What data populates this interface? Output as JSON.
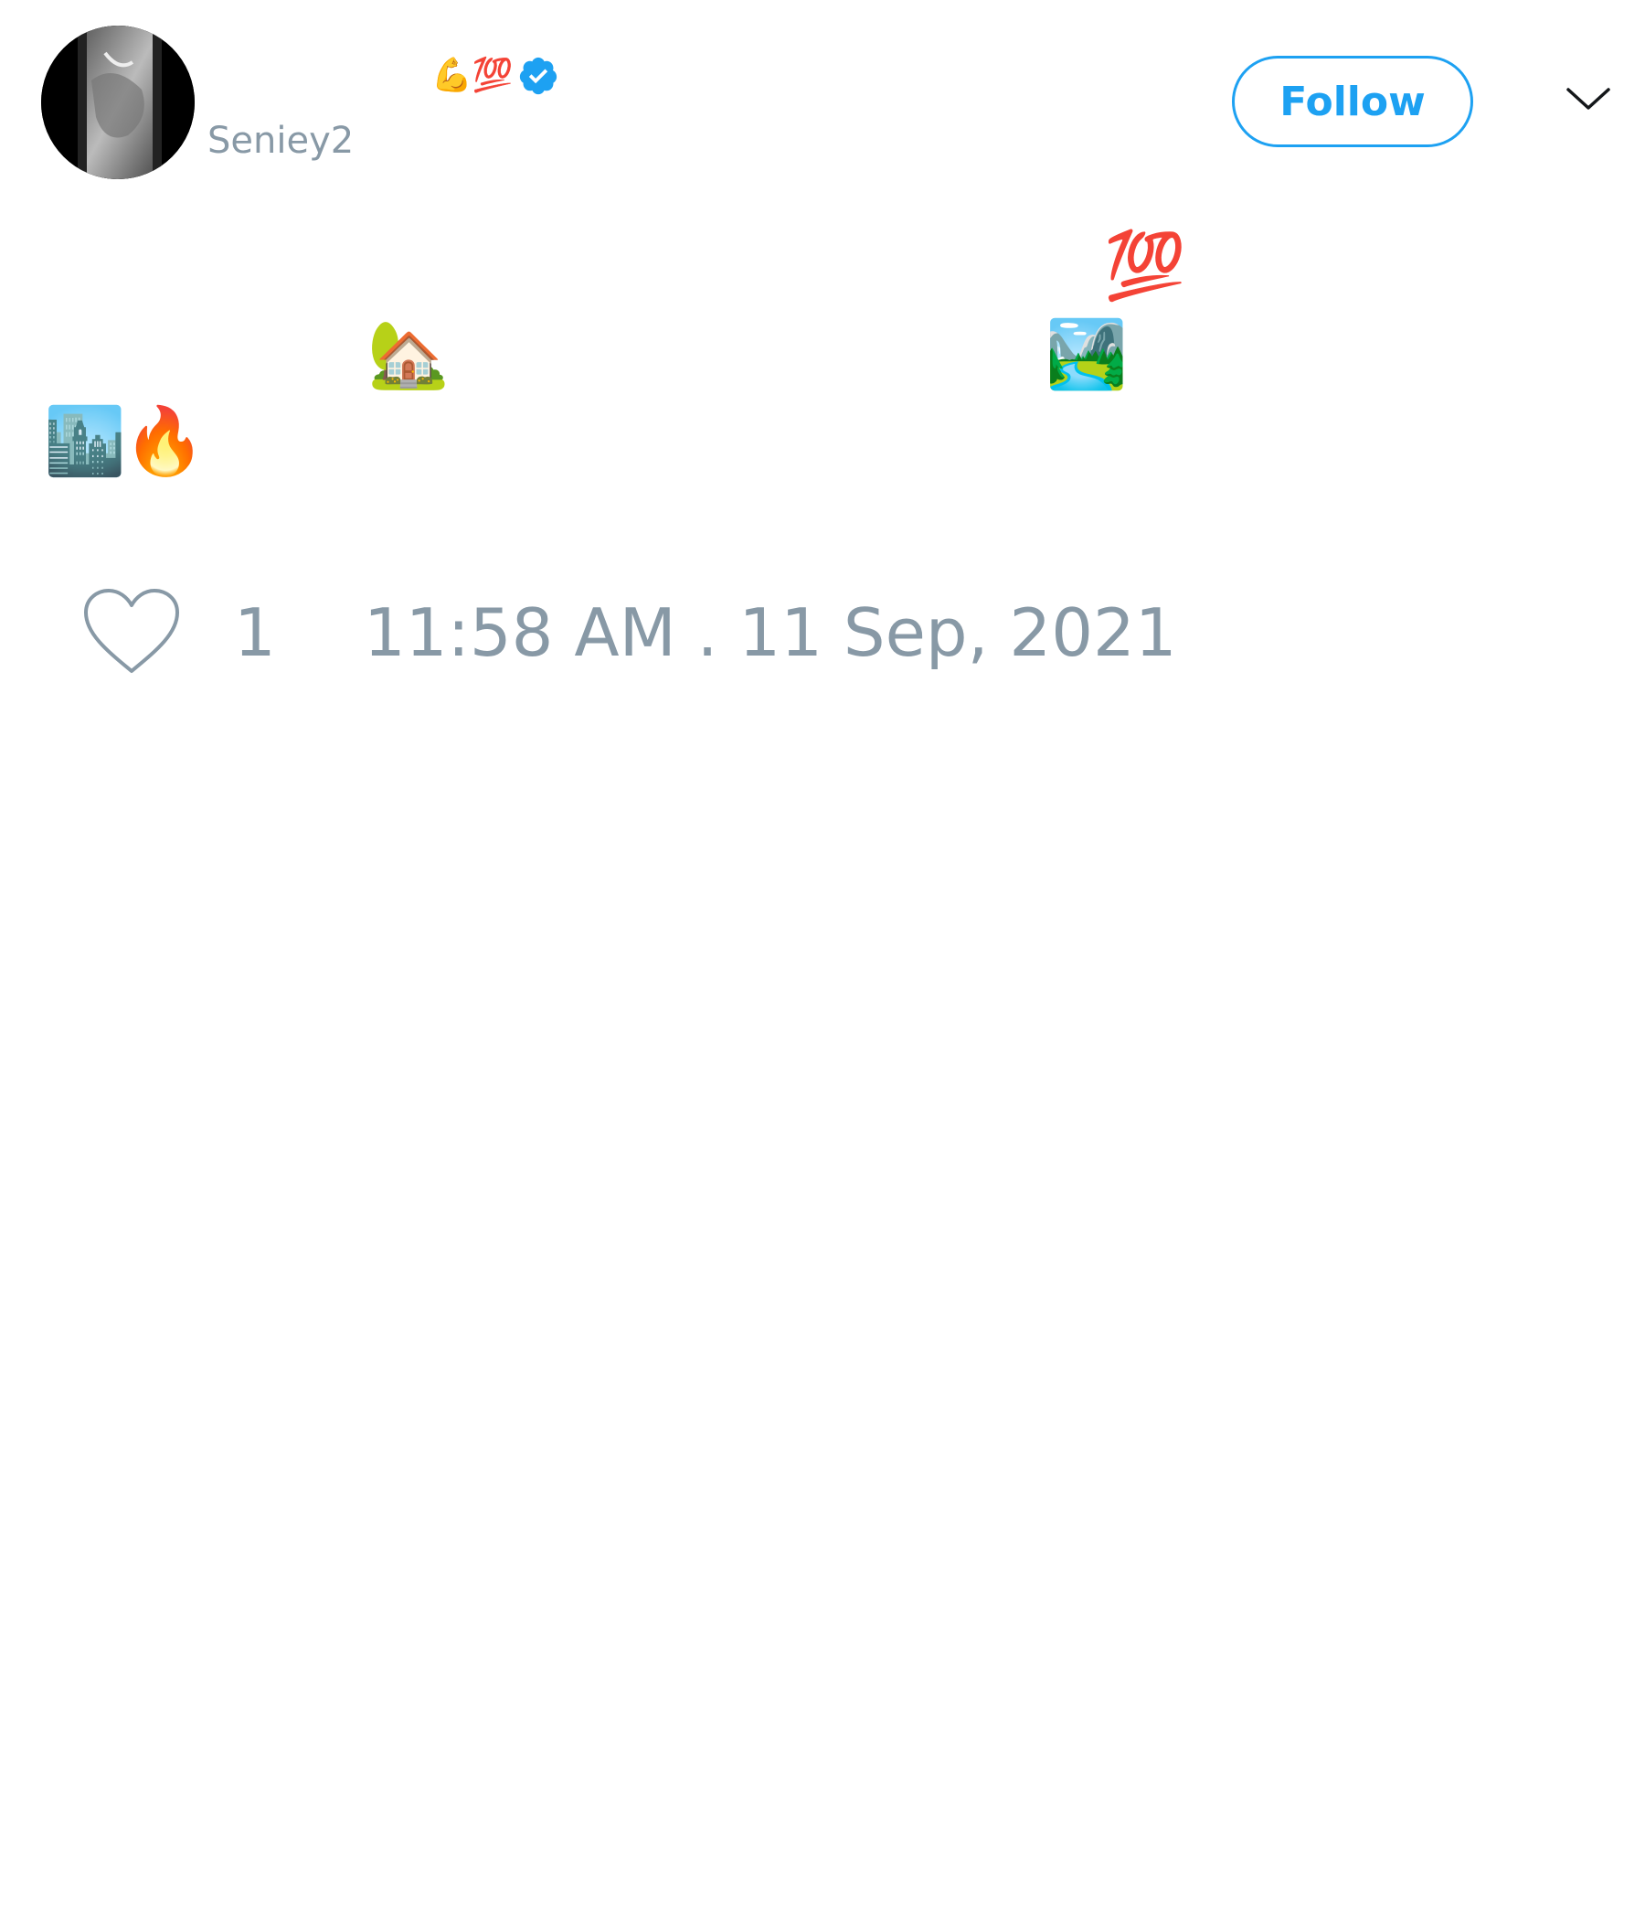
{
  "user": {
    "display_name_emojis": "💪💯",
    "verified_icon": "verified-badge-icon",
    "handle": "Seniey2"
  },
  "header": {
    "follow_label": "Follow",
    "menu_icon": "chevron-down-icon"
  },
  "tweet": {
    "emoji_hundred": "💯",
    "emoji_house": "🏡",
    "emoji_park": "🏞️",
    "emoji_city": "🏙️",
    "emoji_fire": "🔥"
  },
  "footer": {
    "like_icon": "heart-icon",
    "like_count": "1",
    "timestamp": "11:58 AM . 11 Sep, 2021"
  },
  "colors": {
    "accent": "#1da1f2",
    "muted": "#8899a6"
  }
}
